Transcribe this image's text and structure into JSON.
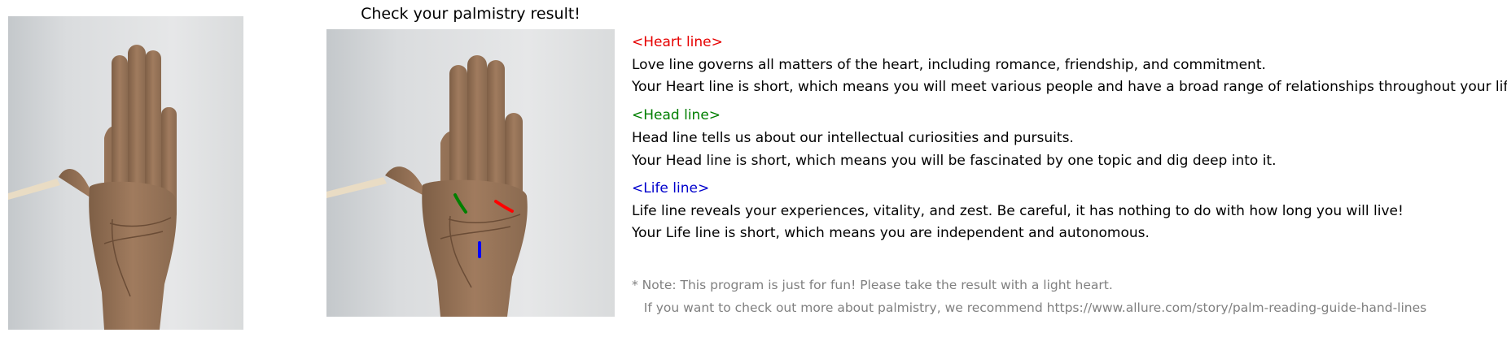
{
  "title": "Check your palmistry result!",
  "colors": {
    "heart": "#e60000",
    "head": "#007f00",
    "life": "#0000cc",
    "note": "#808080",
    "skin": "#9a7659",
    "wall": "#dfe1e2"
  },
  "heart": {
    "heading": "<Heart line>",
    "description": "Love line governs all matters of the heart, including romance, friendship, and commitment.",
    "result": "Your Heart line is short, which means you will meet various people and have a broad range of relationships throughout your life."
  },
  "head": {
    "heading": "<Head line>",
    "description": "Head line tells us about our intellectual curiosities and pursuits.",
    "result": "Your Head line is short, which means you will be fascinated by one topic and dig deep into it."
  },
  "life": {
    "heading": "<Life line>",
    "description": "Life line reveals your experiences, vitality, and zest. Be careful, it has nothing to do with how long you will live!",
    "result": "Your Life line is short, which means you are independent and autonomous."
  },
  "note": {
    "line1": "* Note: This program is just for fun! Please take the result with a light heart.",
    "line2": "   If you want to check out more about palmistry, we recommend https://www.allure.com/story/palm-reading-guide-hand-lines"
  }
}
